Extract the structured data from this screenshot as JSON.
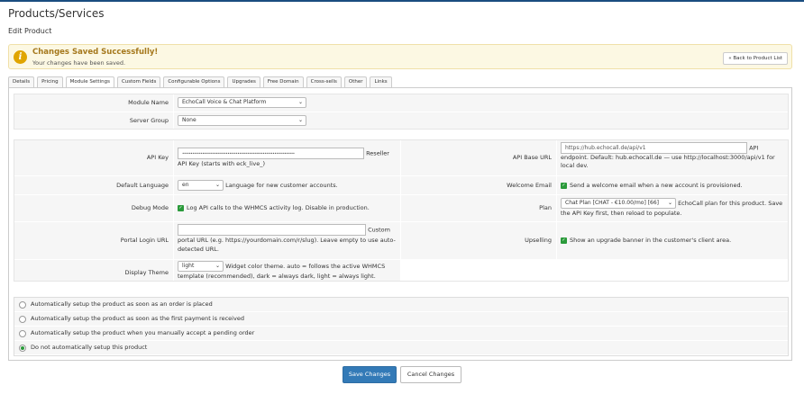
{
  "page": {
    "title": "Products/Services",
    "subtitle": "Edit Product"
  },
  "alert": {
    "title": "Changes Saved Successfully!",
    "message": "Your changes have been saved.",
    "back_button": "« Back to Product List",
    "icon": "info-icon",
    "color": "#fcf8e3"
  },
  "tabs": [
    "Details",
    "Pricing",
    "Module Settings",
    "Custom Fields",
    "Configurable Options",
    "Upgrades",
    "Free Domain",
    "Cross-sells",
    "Other",
    "Links"
  ],
  "active_tab": "Module Settings",
  "module": {
    "module_name_label": "Module Name",
    "module_name_value": "EchoCall Voice & Chat Platform",
    "server_group_label": "Server Group",
    "server_group_value": "None"
  },
  "settings": {
    "api_key_label": "API Key",
    "api_key_value": "•••••••••••••••••••••••••••••••••••••••••••••••••••••••••••••••••••",
    "api_key_help_a": "Reseller",
    "api_key_help_b": "API Key (starts with eck_live_)",
    "api_base_url_label": "API Base URL",
    "api_base_url_value": "https://hub.echocall.de/api/v1",
    "api_base_url_help_a": "API",
    "api_base_url_help_b": "endpoint. Default: hub.echocall.de — use http://localhost:3000/api/v1 for local dev.",
    "default_language_label": "Default Language",
    "default_language_value": "en",
    "default_language_help": "Language for new customer accounts.",
    "welcome_email_label": "Welcome Email",
    "welcome_email_help": "Send a welcome email when a new account is provisioned.",
    "debug_mode_label": "Debug Mode",
    "debug_mode_help": "Log API calls to the WHMCS activity log. Disable in production.",
    "plan_label": "Plan",
    "plan_value": "Chat Plan [CHAT - €10.00/mo] [66]",
    "plan_help_a": "EchoCall plan for this product. Save",
    "plan_help_b": "the API Key first, then reload to populate.",
    "portal_login_url_label": "Portal Login URL",
    "portal_login_url_help_a": "Custom",
    "portal_login_url_help_b": "portal URL (e.g. https://yourdomain.com/r/slug). Leave empty to use auto-detected URL.",
    "upselling_label": "Upselling",
    "upselling_help": "Show an upgrade banner in the customer's client area.",
    "display_theme_label": "Display Theme",
    "display_theme_value": "light",
    "display_theme_help": "Widget color theme. auto = follows the active WHMCS template (recommended), dark = always dark, light = always light."
  },
  "setup_options": [
    {
      "label": "Automatically setup the product as soon as an order is placed",
      "selected": false
    },
    {
      "label": "Automatically setup the product as soon as the first payment is received",
      "selected": false
    },
    {
      "label": "Automatically setup the product when you manually accept a pending order",
      "selected": false
    },
    {
      "label": "Do not automatically setup this product",
      "selected": true
    }
  ],
  "buttons": {
    "save": "Save Changes",
    "cancel": "Cancel Changes"
  },
  "colors": {
    "accent": "#337ab7",
    "checkbox": "#2a9a3a"
  }
}
